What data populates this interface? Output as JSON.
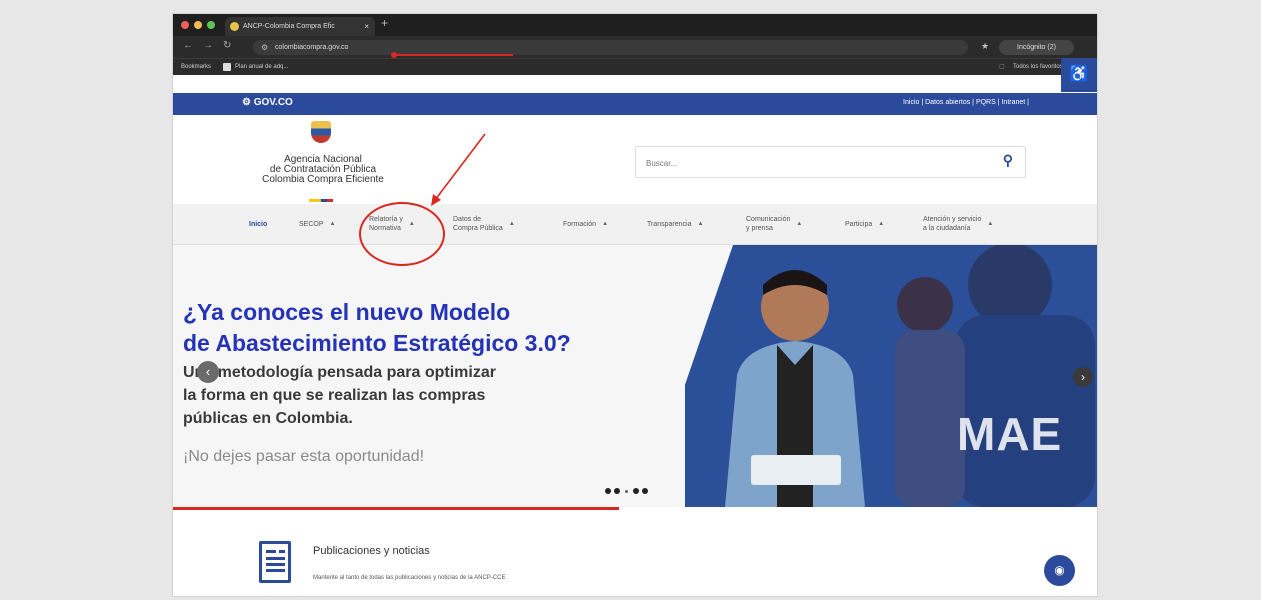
{
  "browser": {
    "tab_title": "ANCP-Colombia Compra Efic",
    "tab_close": "×",
    "new_tab": "+",
    "url": "colombiacompra.gov.co",
    "profile": "Incógnito (2)",
    "bookmarks": [
      "Bookmarks",
      "Plan anual de adq..."
    ],
    "all_bookmarks": "Todos los favoritos"
  },
  "gov": {
    "logo": "GOV.CO",
    "links": "Inicio | Datos abiertos | PQRS | Intranet |"
  },
  "brand": {
    "line1": "Agencia Nacional",
    "line2": "de Contratación Pública",
    "line3": "Colombia Compra Eficiente"
  },
  "search": {
    "placeholder": "Buscar..."
  },
  "menu": [
    {
      "l1": "Inicio",
      "l2": ""
    },
    {
      "l1": "SECOP",
      "l2": ""
    },
    {
      "l1": "Relatoría y",
      "l2": "Normativa"
    },
    {
      "l1": "Datos de",
      "l2": "Compra Pública"
    },
    {
      "l1": "Formación",
      "l2": ""
    },
    {
      "l1": "Transparencia",
      "l2": ""
    },
    {
      "l1": "Comunicación",
      "l2": "y prensa"
    },
    {
      "l1": "Participa",
      "l2": ""
    },
    {
      "l1": "Atención y servicio",
      "l2": "a la ciudadanía"
    }
  ],
  "hero": {
    "title_line1": "¿Ya conoces el nuevo Modelo",
    "title_line2": "de Abastecimiento Estratégico 3.0?",
    "sub_line1": "Una metodología pensada para optimizar",
    "sub_line2": "la forma en que se realizan las compras",
    "sub_line3": "públicas en Colombia.",
    "tagline": "¡No dejes pasar esta oportunidad!",
    "photo_text": "MAE"
  },
  "news": {
    "title": "Publicaciones y noticias",
    "subtitle": "Mantente al tanto de todas las publicaciones y noticias de la ANCP-CCE"
  },
  "colors": {
    "gov_blue": "#2c4a9c",
    "hero_title": "#2433b8",
    "annotation_red": "#d8281f"
  }
}
